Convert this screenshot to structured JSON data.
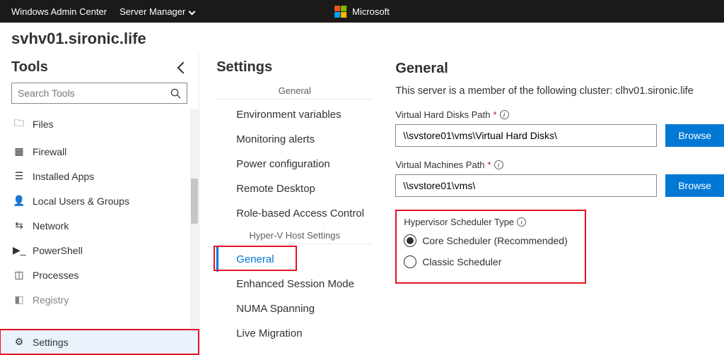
{
  "topbar": {
    "left1": "Windows Admin Center",
    "left2": "Server Manager",
    "brand": "Microsoft"
  },
  "server_name": "svhv01.sironic.life",
  "tools": {
    "heading": "Tools",
    "search_placeholder": "Search Tools",
    "items": [
      "Files",
      "Firewall",
      "Installed Apps",
      "Local Users & Groups",
      "Network",
      "PowerShell",
      "Processes",
      "Registry"
    ],
    "settings": "Settings"
  },
  "settings": {
    "heading": "Settings",
    "groups": [
      {
        "label": "General",
        "items": [
          "Environment variables",
          "Monitoring alerts",
          "Power configuration",
          "Remote Desktop",
          "Role-based Access Control"
        ]
      },
      {
        "label": "Hyper-V Host Settings",
        "items": [
          "General",
          "Enhanced Session Mode",
          "NUMA Spanning",
          "Live Migration"
        ]
      }
    ],
    "selected": "General"
  },
  "main": {
    "heading": "General",
    "desc": "This server is a member of the following cluster: clhv01.sironic.life",
    "vhd_label": "Virtual Hard Disks Path",
    "vhd_value": "\\\\svstore01\\vms\\Virtual Hard Disks\\",
    "vm_label": "Virtual Machines Path",
    "vm_value": "\\\\svstore01\\vms\\",
    "browse": "Browse",
    "scheduler_label": "Hypervisor Scheduler Type",
    "scheduler_options": [
      "Core Scheduler (Recommended)",
      "Classic Scheduler"
    ],
    "scheduler_selected": 0
  }
}
